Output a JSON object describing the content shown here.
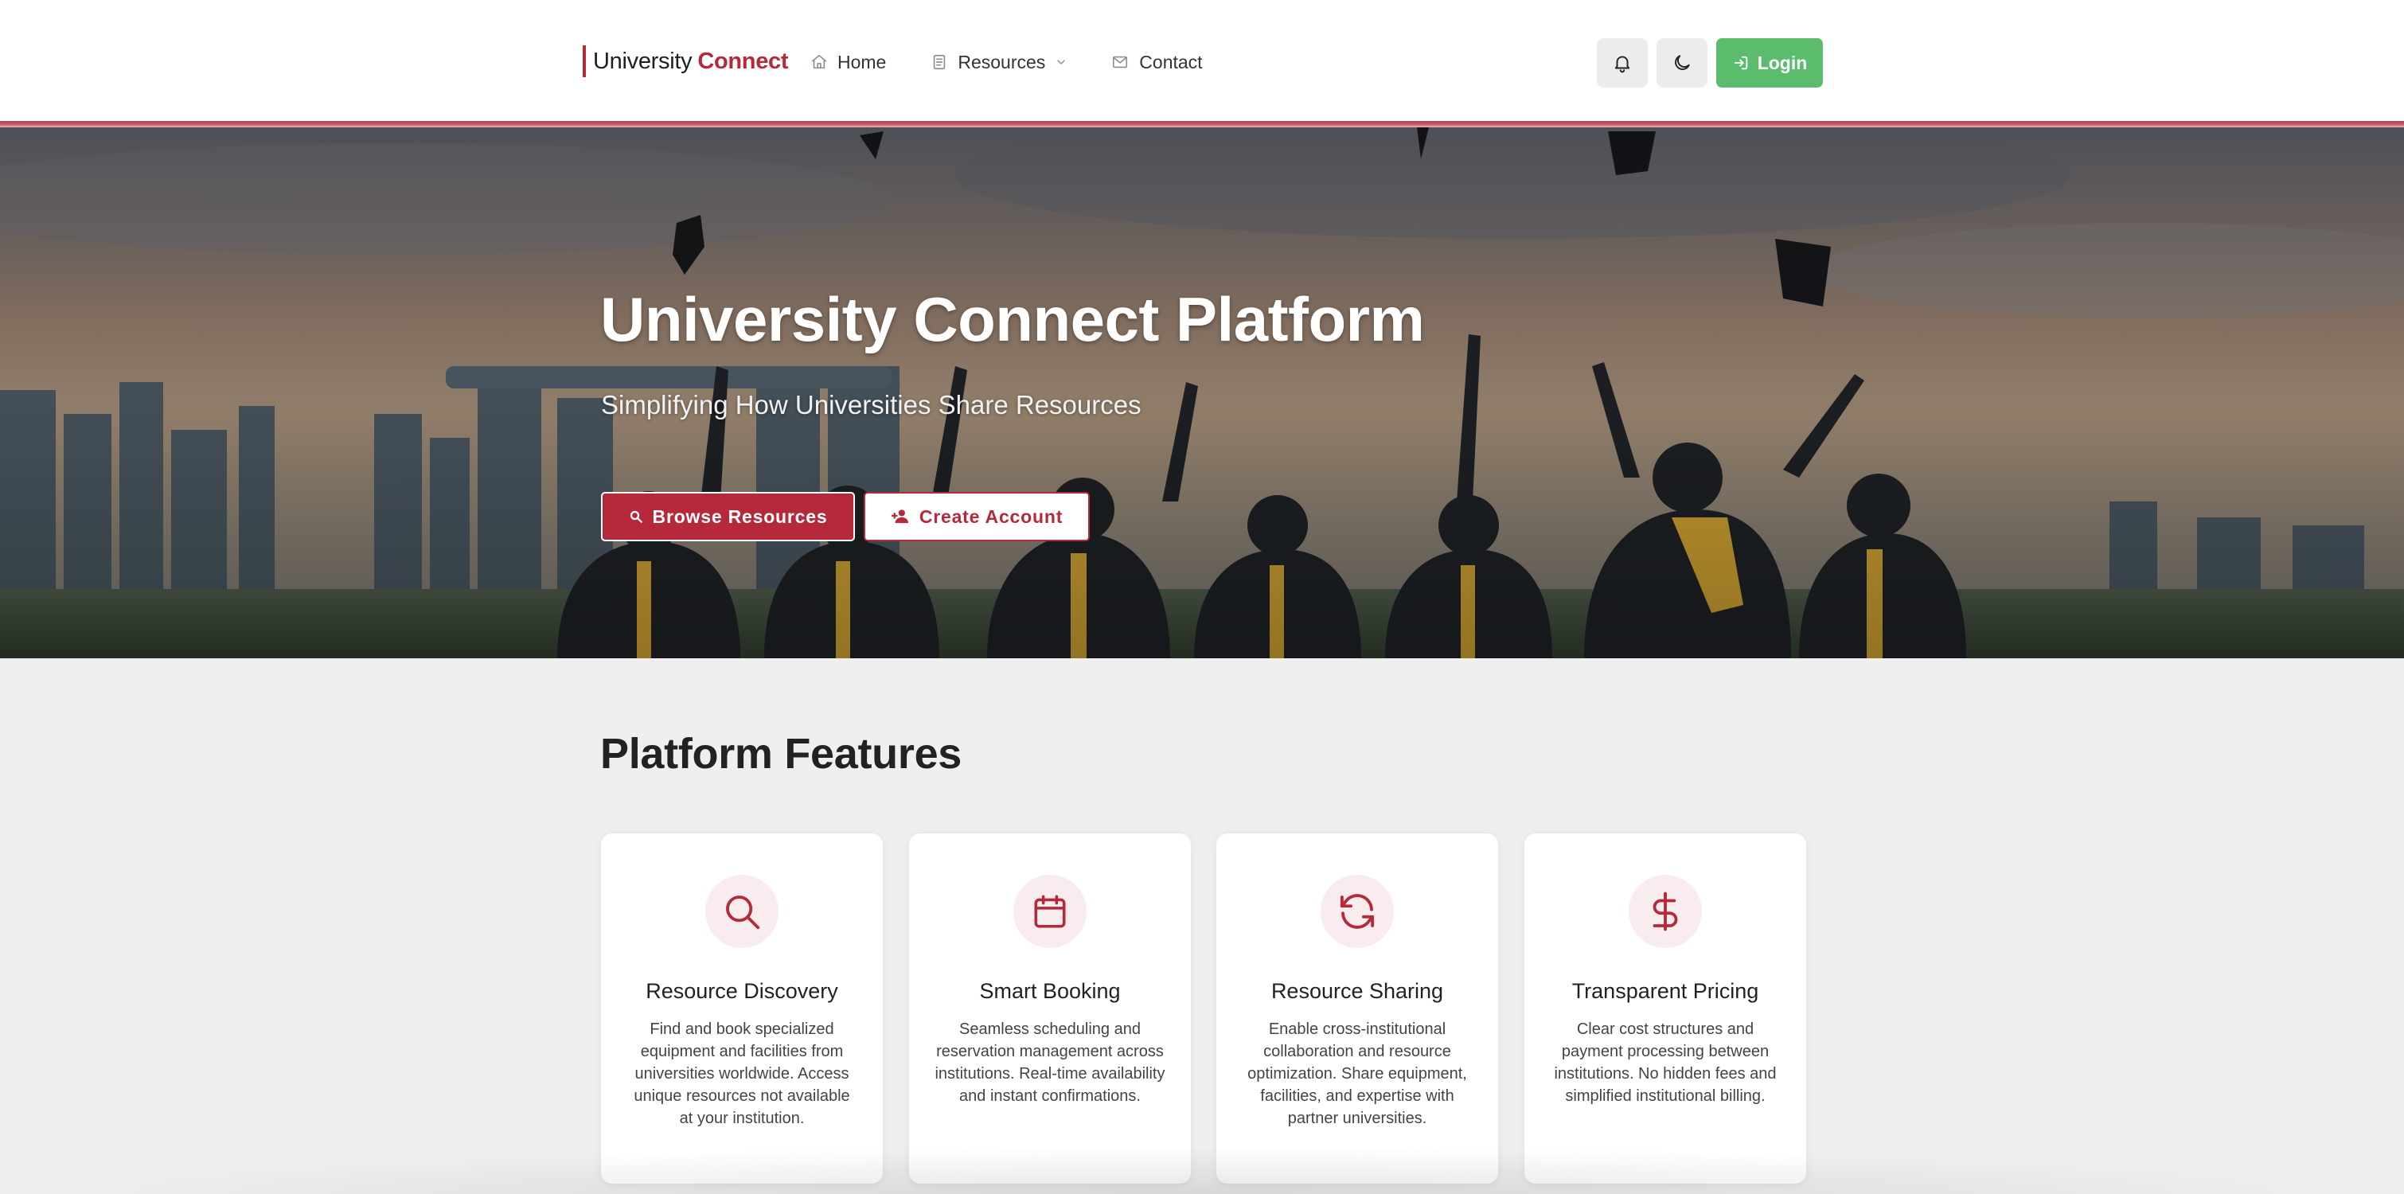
{
  "navbar": {
    "brand": {
      "primary": "University",
      "accent": "Connect"
    },
    "links": [
      {
        "label": "Home",
        "icon": "home-icon"
      },
      {
        "label": "Resources",
        "icon": "document-icon",
        "has_dropdown": true
      },
      {
        "label": "Contact",
        "icon": "mail-icon"
      }
    ],
    "notifications_icon": "bell-icon",
    "theme_toggle_icon": "moon-icon",
    "login_label": "Login"
  },
  "hero": {
    "title": "University Connect Platform",
    "subtitle": "Simplifying How Universities Share Resources",
    "primary_button": "Browse Resources",
    "secondary_button": "Create Account"
  },
  "features": {
    "heading": "Platform Features",
    "items": [
      {
        "icon": "search-icon",
        "title": "Resource Discovery",
        "description": "Find and book specialized equipment and facilities from universities worldwide. Access unique resources not available at your institution."
      },
      {
        "icon": "calendar-icon",
        "title": "Smart Booking",
        "description": "Seamless scheduling and reservation management across institutions. Real-time availability and instant confirmations."
      },
      {
        "icon": "refresh-icon",
        "title": "Resource Sharing",
        "description": "Enable cross-institutional collaboration and resource optimization. Share equipment, facilities, and expertise with partner universities."
      },
      {
        "icon": "dollar-icon",
        "title": "Transparent Pricing",
        "description": "Clear cost structures and payment processing between institutions. No hidden fees and simplified institutional billing."
      }
    ]
  },
  "colors": {
    "brand": "#b5293b",
    "login": "#5cbc6d",
    "page_background": "#efefef"
  }
}
